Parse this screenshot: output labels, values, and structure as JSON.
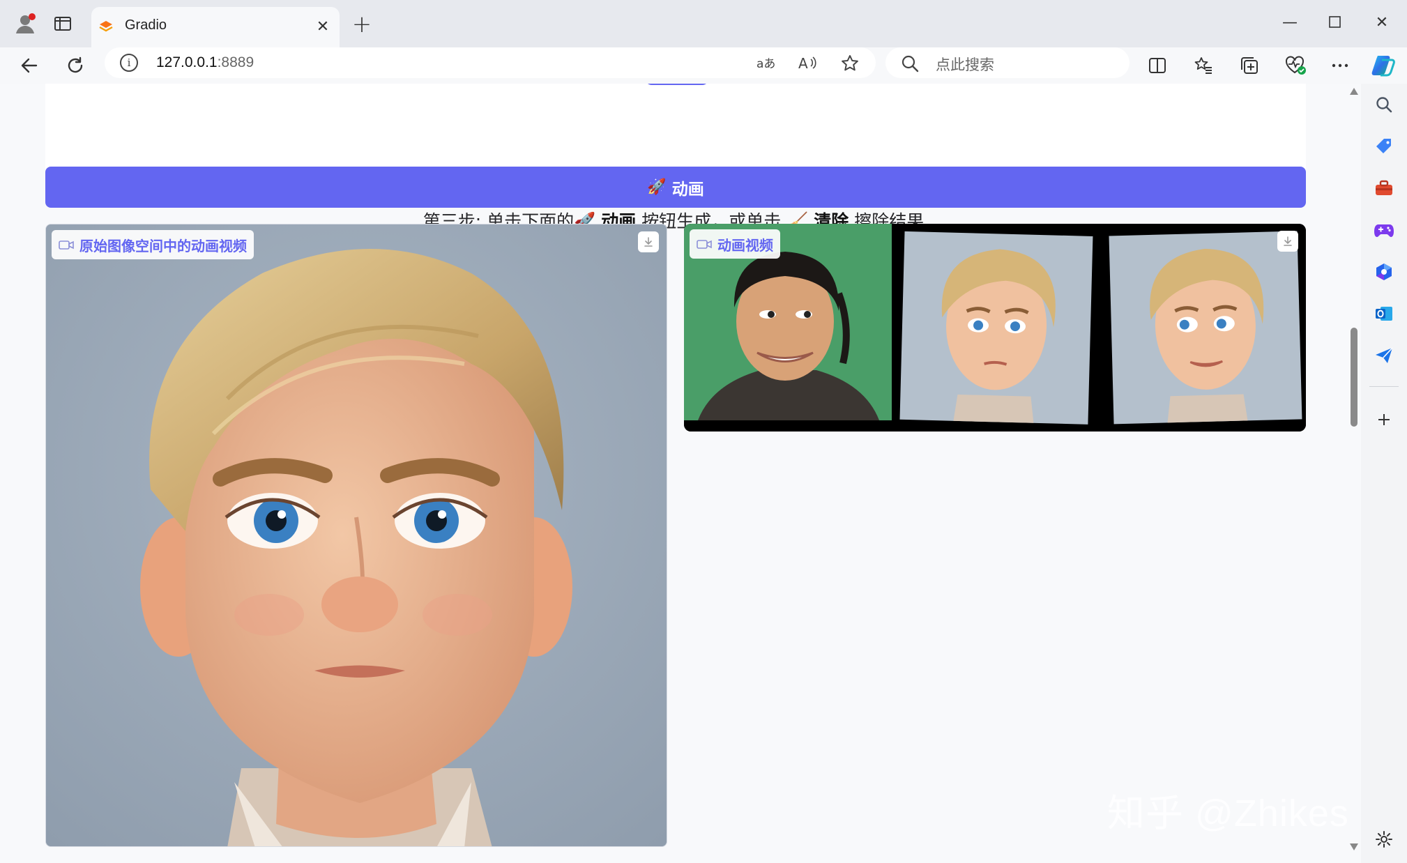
{
  "browser": {
    "tab_title": "Gradio",
    "url_host": "127.0.0.1",
    "url_port": ":8889",
    "search_placeholder": "点此搜索",
    "icons": [
      "profile-icon",
      "tab-actions-icon",
      "close-icon",
      "new-tab-icon",
      "minimize-icon",
      "maximize-icon",
      "window-close-icon",
      "back-icon",
      "refresh-icon",
      "site-info-icon",
      "translate-icon",
      "read-aloud-icon",
      "favorite-star-icon",
      "search-icon",
      "split-screen-icon",
      "favorites-icon",
      "collections-icon",
      "browser-essentials-icon",
      "more-icon",
      "copilot-icon"
    ]
  },
  "sidebar": {
    "items": [
      {
        "name": "search-icon",
        "color": "#4b5563"
      },
      {
        "name": "shopping-tag-icon",
        "color": "#3b82f6"
      },
      {
        "name": "tools-icon",
        "color": "#e04a2f"
      },
      {
        "name": "games-icon",
        "color": "#7c3aed"
      },
      {
        "name": "microsoft365-icon",
        "color": "#2563eb"
      },
      {
        "name": "outlook-icon",
        "color": "#0a64c8"
      },
      {
        "name": "send-icon",
        "color": "#1a73e8"
      }
    ]
  },
  "page": {
    "step3": {
      "prefix": "第三步: 单击下面的",
      "animate_word": "动画",
      "middle": "按钮生成，或单击",
      "clear_word": "清除",
      "suffix": "擦除结果"
    },
    "animate_button": {
      "icon": "🚀",
      "label": "动画"
    },
    "left_video": {
      "label": "原始图像空间中的动画视频"
    },
    "right_video": {
      "label": "动画视频"
    },
    "accent_color": "#6366f1"
  },
  "watermark": "知乎 @Zhikes"
}
